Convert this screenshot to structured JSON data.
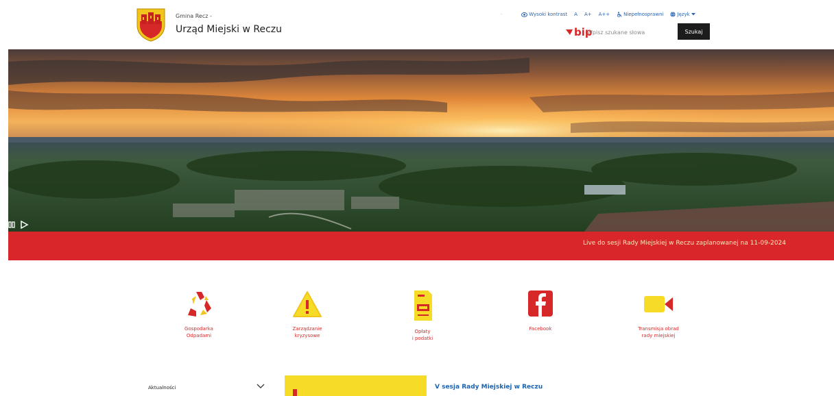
{
  "header": {
    "subtitle": "Gmina Recz -",
    "title": "Urząd Miejski w Reczu",
    "crest_icon": "coat-of-arms-icon"
  },
  "utility": {
    "contrast": "Wysoki kontrast",
    "font_a": "A",
    "font_a_plus": "A+",
    "font_a_plus_plus": "A++",
    "disabled": "Niepełnosprawni",
    "language": "Język"
  },
  "bip": {
    "label": "bip"
  },
  "search": {
    "placeholder": "Wpisz szukane słowa",
    "button": "Szukaj"
  },
  "hero": {
    "caption": "Live do sesji Rady Miejskiej w Reczu zaplanowanej na 11-09-2024"
  },
  "quick_links": [
    {
      "label": "Gospodarka\nOdpadami",
      "icon": "recycle-icon"
    },
    {
      "label": "Zarządzanie\nkryzysowe",
      "icon": "warning-icon"
    },
    {
      "label": "Opłaty\ni podatki",
      "icon": "document-icon"
    },
    {
      "label": "Facebook",
      "icon": "facebook-icon"
    },
    {
      "label": "Transmisja obrad\nrady miejskiej",
      "icon": "video-camera-icon"
    }
  ],
  "news": {
    "dropdown_label": "Aktualności",
    "headline": "V sesja Rady Miejskiej w Reczu"
  },
  "colors": {
    "brand_red": "#d9262a",
    "link_blue": "#2a63b0",
    "accent_yellow": "#f7dc27"
  }
}
